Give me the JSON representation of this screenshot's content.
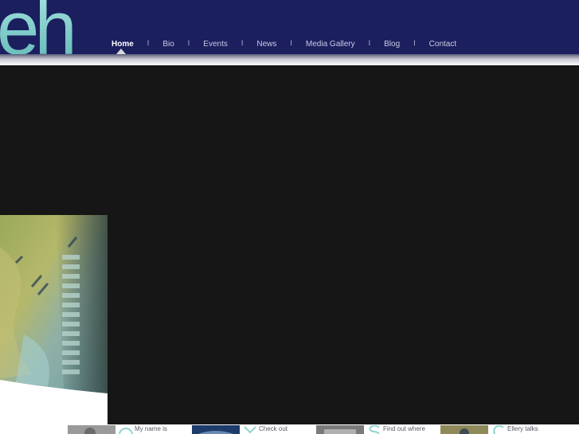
{
  "logo": {
    "text": "eh"
  },
  "nav": {
    "items": [
      {
        "label": "Home",
        "active": true
      },
      {
        "label": "Bio"
      },
      {
        "label": "Events"
      },
      {
        "label": "News"
      },
      {
        "label": "Media Gallery"
      },
      {
        "label": "Blog"
      },
      {
        "label": "Contact"
      }
    ],
    "separator": "I"
  },
  "colors": {
    "header_bg": "#1b1f5e",
    "stage_bg": "#161616",
    "accent_teal": "#8fd3d0"
  },
  "teasers": [
    {
      "letter_icon": "o-glyph-icon",
      "text": "My name is"
    },
    {
      "letter_icon": "y-glyph-icon",
      "text": "Check out"
    },
    {
      "letter_icon": "s-glyph-icon",
      "text": "Find out where"
    },
    {
      "letter_icon": "g-glyph-icon",
      "text": "Ellery talks"
    }
  ]
}
